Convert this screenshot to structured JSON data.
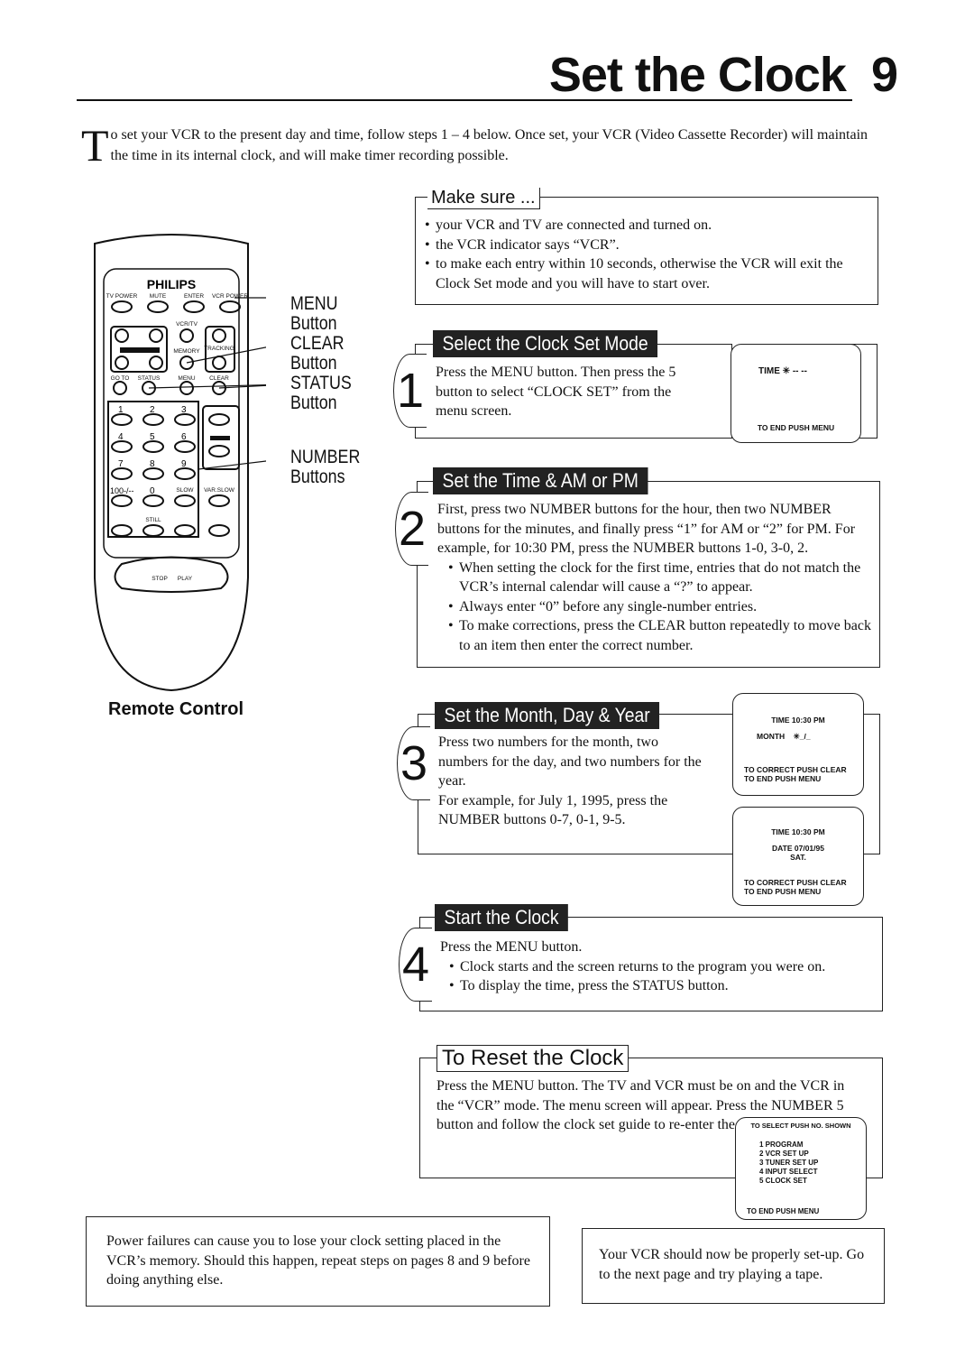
{
  "page": {
    "title": "Set the Clock",
    "number": "9"
  },
  "intro": {
    "dropcap": "T",
    "text": "o set your VCR to the present day and time, follow steps 1 – 4 below. Once set, your VCR (Video Cassette Recorder) will maintain the time in its internal clock, and will make timer recording possible."
  },
  "make_sure": {
    "title": "Make sure ...",
    "items": [
      "your VCR and TV are connected and turned on.",
      "the VCR indicator says “VCR”.",
      "to make each entry within 10 seconds, otherwise the VCR will exit the Clock Set mode and you will have to start over."
    ]
  },
  "remote": {
    "brand": "PHILIPS",
    "caption": "Remote Control",
    "top_buttons": [
      "TV POWER",
      "MUTE",
      "ENTER",
      "VCR POWER"
    ],
    "mid_labels": [
      "VCR/TV",
      "MEMORY",
      "TRACKING",
      "GO TO",
      "STATUS",
      "MENU",
      "CLEAR"
    ],
    "keys": [
      "1",
      "2",
      "3",
      "4",
      "5",
      "6",
      "7",
      "8",
      "9",
      "100-/--",
      "0"
    ],
    "bottom_labels": [
      "SLOW",
      "VAR.SLOW",
      "STILL",
      "STOP",
      "PLAY"
    ],
    "callouts": [
      {
        "line1": "MENU",
        "line2": "Button"
      },
      {
        "line1": "CLEAR",
        "line2": "Button"
      },
      {
        "line1": "STATUS",
        "line2": "Button"
      },
      {
        "line1": "NUMBER",
        "line2": "Buttons"
      }
    ]
  },
  "steps": [
    {
      "number": "1",
      "title": "Select the Clock Set Mode",
      "text": "Press the MENU button. Then press the 5 button to select “CLOCK SET” from the menu screen.",
      "screen": {
        "line1": "TIME",
        "line2": "-- --",
        "footer": "TO END PUSH MENU"
      }
    },
    {
      "number": "2",
      "title": "Set the Time & AM or PM",
      "text": "First, press two NUMBER buttons for the hour, then two NUMBER buttons for the minutes, and finally press “1” for AM or “2” for PM. For example, for 10:30 PM, press the NUMBER buttons 1-0, 3-0, 2.",
      "items": [
        "When setting the clock for the first time, entries that do not match the VCR’s internal calendar will cause a “?” to appear.",
        "Always enter “0” before any single-number entries.",
        "To make corrections, press the CLEAR button repeatedly to move back to an item then enter the correct number."
      ]
    },
    {
      "number": "3",
      "title": "Set the Month, Day & Year",
      "text": "Press two numbers for the month, two numbers for the day, and two numbers for the year.",
      "example": "For example, for July 1, 1995, press the NUMBER buttons 0-7, 0-1, 9-5.",
      "screens": [
        {
          "line1": "TIME 10:30 PM",
          "line2": "MONTH",
          "line3": "_/_",
          "footer1": "TO CORRECT PUSH CLEAR",
          "footer2": "TO END PUSH MENU"
        },
        {
          "line1": "TIME 10:30 PM",
          "line2": "DATE 07/01/95",
          "line3": "SAT.",
          "footer1": "TO CORRECT PUSH CLEAR",
          "footer2": "TO END PUSH MENU"
        }
      ]
    },
    {
      "number": "4",
      "title": "Start the Clock",
      "text": "Press the MENU button.",
      "items": [
        "Clock starts and the screen returns to the program you were on.",
        "To display the time, press the STATUS button."
      ]
    }
  ],
  "reset": {
    "title": "To Reset the Clock",
    "text": "Press the MENU button. The TV and VCR must be on and the VCR in the “VCR” mode. The menu screen will appear. Press the NUMBER 5 button and follow the clock set guide to re-enter the new date and time.",
    "screen": {
      "header": "TO SELECT PUSH NO. SHOWN",
      "items": [
        "1 PROGRAM",
        "2 VCR SET UP",
        "3 TUNER SET UP",
        "4 INPUT SELECT",
        "5 CLOCK SET"
      ],
      "footer": "TO END PUSH MENU"
    }
  },
  "notes": {
    "power_failure": "Power failures can cause you to lose your clock setting placed in the VCR’s memory. Should this happen, repeat steps on pages 8 and 9 before doing anything else.",
    "next": "Your VCR should now be properly set-up. Go to the next page and try playing a tape."
  }
}
